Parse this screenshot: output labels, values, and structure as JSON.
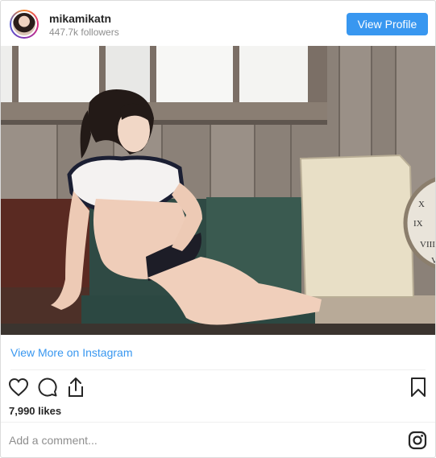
{
  "header": {
    "username": "mikamikatn",
    "followers": "447.7k followers",
    "view_profile_label": "View Profile"
  },
  "post": {
    "view_more_label": "View More on Instagram",
    "likes": "7,990 likes",
    "comment_placeholder": "Add a comment..."
  },
  "icons": {
    "like": "heart-icon",
    "comment": "comment-bubble-icon",
    "share": "share-icon",
    "save": "bookmark-icon",
    "brand": "instagram-logo-icon"
  },
  "colors": {
    "accent": "#3897f0",
    "text": "#262626",
    "muted": "#8e8e8e",
    "border": "#dbdbdb"
  }
}
